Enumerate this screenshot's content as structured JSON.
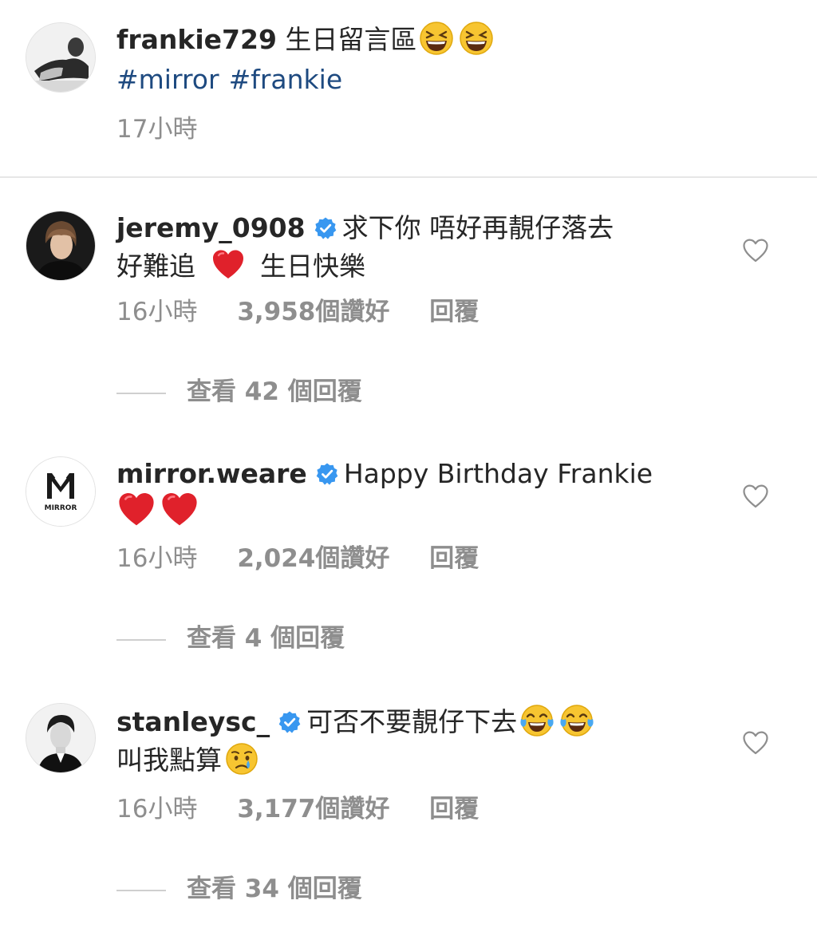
{
  "post": {
    "username": "frankie729",
    "caption": "生日留言區",
    "hashtags": [
      "#mirror",
      "#frankie"
    ],
    "time": "17小時",
    "emoji": "grinning-squinting-face-emoji"
  },
  "comments": [
    {
      "username": "jeremy_0908",
      "verified": true,
      "text_line1": "求下你 唔好再靚仔落去",
      "text_line2a": "好難追",
      "text_line2b": "生日快樂",
      "time": "16小時",
      "likes": "3,958個讚好",
      "reply_label": "回覆",
      "view_replies": "查看 42 個回覆"
    },
    {
      "username": "mirror.weare",
      "verified": true,
      "text_line1": "Happy Birthday Frankie",
      "time": "16小時",
      "likes": "2,024個讚好",
      "reply_label": "回覆",
      "view_replies": "查看 4 個回覆",
      "avatar_logo_text": "MIRROR"
    },
    {
      "username": "stanleysc_",
      "verified": true,
      "text_line1": "可否不要靚仔下去",
      "text_line2": "叫我點算",
      "time": "16小時",
      "likes": "3,177個讚好",
      "reply_label": "回覆",
      "view_replies": "查看 34 個回覆"
    }
  ],
  "colors": {
    "text": "#262626",
    "muted": "#8e8e8e",
    "hashtag": "#1e4a80",
    "verified": "#3897f0",
    "heart_emoji": "#e0212b"
  }
}
